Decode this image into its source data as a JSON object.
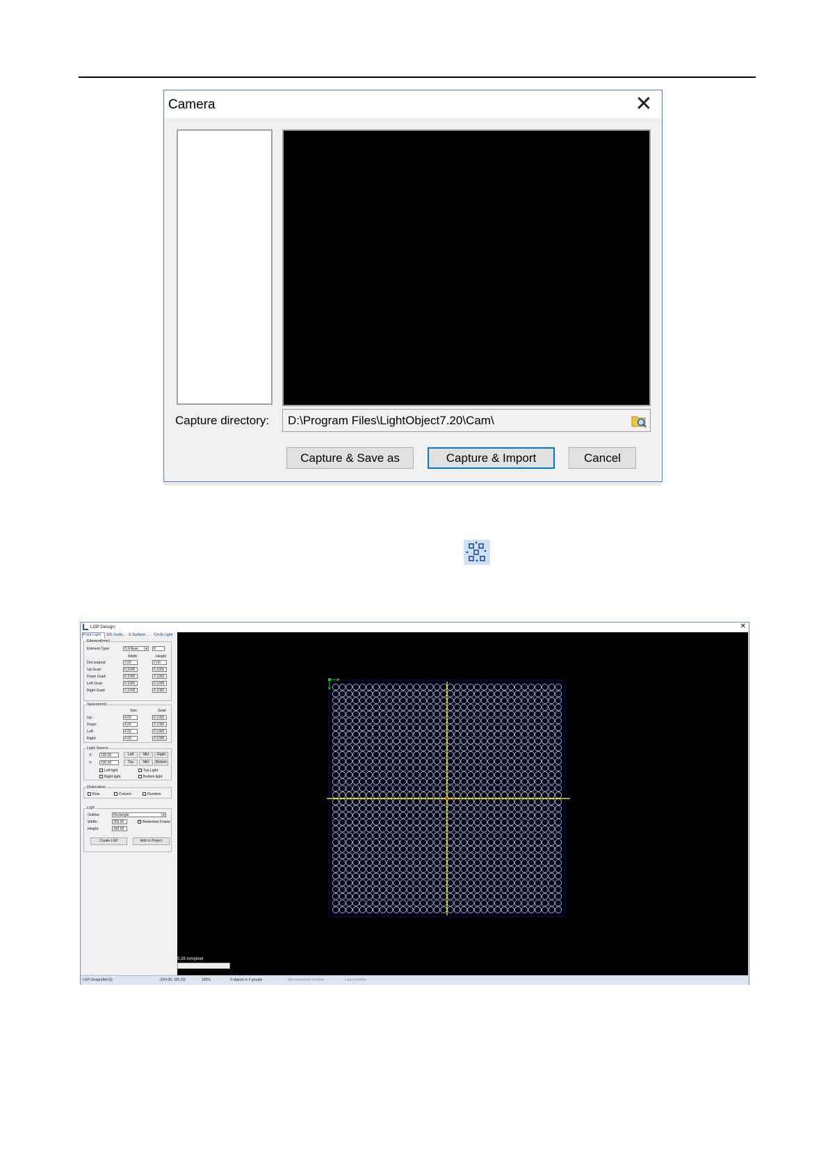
{
  "camera_dialog": {
    "title": "Camera",
    "close_glyph": "✕",
    "capture_directory_label": "Capture directory:",
    "capture_directory_value": "D:\\Program Files\\LightObject7.20\\Cam\\",
    "browse_icon": "folder-search-icon",
    "buttons": {
      "capture_save_as": "Capture & Save as",
      "capture_import": "Capture & Import",
      "cancel": "Cancel"
    }
  },
  "toolbar_icon": "lgp-design-icon",
  "lgp_window": {
    "title": "LGP Design",
    "close_glyph": "✕",
    "tabs": [
      "Point Light",
      "3/D Surfa...",
      "S Surface...",
      "Circle Light"
    ],
    "element": {
      "title": "Element(mm)",
      "type_label": "Element Type:",
      "type_value": "O Ellipse",
      "count_value": "8",
      "width_header": "Width",
      "height_header": "Height",
      "rows": [
        {
          "label": "Dot original:",
          "width": "2.00",
          "height": "2.00"
        },
        {
          "label": "Up Grad:",
          "width": "0.1000",
          "height": "0.1000"
        },
        {
          "label": "Down Grad:",
          "width": "0.1000",
          "height": "0.1000"
        },
        {
          "label": "Left Grad:",
          "width": "0.1000",
          "height": "0.1000"
        },
        {
          "label": "Right Grad:",
          "width": "0.1000",
          "height": "0.1000"
        }
      ]
    },
    "space": {
      "title": "Space(mm)",
      "size_header": "Size",
      "grad_header": "Grad",
      "rows": [
        {
          "label": "Up:",
          "size": "4.00",
          "grad": "0.1000"
        },
        {
          "label": "Down:",
          "size": "4.00",
          "grad": "0.1000"
        },
        {
          "label": "Left:",
          "size": "4.00",
          "grad": "0.1000"
        },
        {
          "label": "Right:",
          "size": "4.00",
          "grad": "0.1000"
        }
      ]
    },
    "light_source": {
      "title": "Light Source",
      "x_label": "X:",
      "x_value": "100.00",
      "y_label": "Y:",
      "y_value": "100.00",
      "x_buttons": [
        "Left",
        "Mid",
        "Right"
      ],
      "y_buttons": [
        "Top",
        "Mid",
        "Bottom"
      ],
      "checks": [
        {
          "label": "Left light",
          "checked": false
        },
        {
          "label": "Top Light",
          "checked": false
        },
        {
          "label": "Right light",
          "checked": false
        },
        {
          "label": "Bottom light",
          "checked": false
        }
      ]
    },
    "dislocation": {
      "title": "Dislocation",
      "checks": [
        {
          "label": "Row",
          "checked": false
        },
        {
          "label": "Column",
          "checked": false
        },
        {
          "label": "Random",
          "checked": false
        }
      ]
    },
    "lgp": {
      "title": "LGP",
      "outline_label": "Outline:",
      "outline_value": "Rectangle",
      "width_label": "Width:",
      "width_value": "200.00",
      "height_label": "Height:",
      "height_value": "200.00",
      "redention_label": "Redention Frame",
      "redention_checked": true,
      "create_button": "Create LGP",
      "add_button": "Add to Project"
    },
    "canvas": {
      "scale_text": "0.28 mm/pixel",
      "grid_cols": 34,
      "grid_rows": 34,
      "dot_color": "#ffffff",
      "axis_color": "#f2e600",
      "marker_color": "#22c022"
    },
    "status": {
      "mode": "LGP Design(Alt+Q)",
      "coords": "(264.28, 105.23)",
      "zoom": "100%",
      "objects": "0 objects in 0 groups",
      "machine": "Not connected machine",
      "laser": "Laser position"
    }
  }
}
